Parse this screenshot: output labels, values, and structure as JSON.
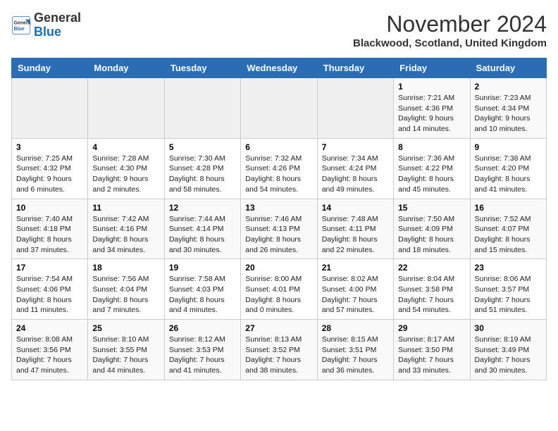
{
  "header": {
    "logo_line1": "General",
    "logo_line2": "Blue",
    "month": "November 2024",
    "location": "Blackwood, Scotland, United Kingdom"
  },
  "weekdays": [
    "Sunday",
    "Monday",
    "Tuesday",
    "Wednesday",
    "Thursday",
    "Friday",
    "Saturday"
  ],
  "weeks": [
    [
      {
        "day": "",
        "info": ""
      },
      {
        "day": "",
        "info": ""
      },
      {
        "day": "",
        "info": ""
      },
      {
        "day": "",
        "info": ""
      },
      {
        "day": "",
        "info": ""
      },
      {
        "day": "1",
        "info": "Sunrise: 7:21 AM\nSunset: 4:36 PM\nDaylight: 9 hours and 14 minutes."
      },
      {
        "day": "2",
        "info": "Sunrise: 7:23 AM\nSunset: 4:34 PM\nDaylight: 9 hours and 10 minutes."
      }
    ],
    [
      {
        "day": "3",
        "info": "Sunrise: 7:25 AM\nSunset: 4:32 PM\nDaylight: 9 hours and 6 minutes."
      },
      {
        "day": "4",
        "info": "Sunrise: 7:28 AM\nSunset: 4:30 PM\nDaylight: 9 hours and 2 minutes."
      },
      {
        "day": "5",
        "info": "Sunrise: 7:30 AM\nSunset: 4:28 PM\nDaylight: 8 hours and 58 minutes."
      },
      {
        "day": "6",
        "info": "Sunrise: 7:32 AM\nSunset: 4:26 PM\nDaylight: 8 hours and 54 minutes."
      },
      {
        "day": "7",
        "info": "Sunrise: 7:34 AM\nSunset: 4:24 PM\nDaylight: 8 hours and 49 minutes."
      },
      {
        "day": "8",
        "info": "Sunrise: 7:36 AM\nSunset: 4:22 PM\nDaylight: 8 hours and 45 minutes."
      },
      {
        "day": "9",
        "info": "Sunrise: 7:38 AM\nSunset: 4:20 PM\nDaylight: 8 hours and 41 minutes."
      }
    ],
    [
      {
        "day": "10",
        "info": "Sunrise: 7:40 AM\nSunset: 4:18 PM\nDaylight: 8 hours and 37 minutes."
      },
      {
        "day": "11",
        "info": "Sunrise: 7:42 AM\nSunset: 4:16 PM\nDaylight: 8 hours and 34 minutes."
      },
      {
        "day": "12",
        "info": "Sunrise: 7:44 AM\nSunset: 4:14 PM\nDaylight: 8 hours and 30 minutes."
      },
      {
        "day": "13",
        "info": "Sunrise: 7:46 AM\nSunset: 4:13 PM\nDaylight: 8 hours and 26 minutes."
      },
      {
        "day": "14",
        "info": "Sunrise: 7:48 AM\nSunset: 4:11 PM\nDaylight: 8 hours and 22 minutes."
      },
      {
        "day": "15",
        "info": "Sunrise: 7:50 AM\nSunset: 4:09 PM\nDaylight: 8 hours and 18 minutes."
      },
      {
        "day": "16",
        "info": "Sunrise: 7:52 AM\nSunset: 4:07 PM\nDaylight: 8 hours and 15 minutes."
      }
    ],
    [
      {
        "day": "17",
        "info": "Sunrise: 7:54 AM\nSunset: 4:06 PM\nDaylight: 8 hours and 11 minutes."
      },
      {
        "day": "18",
        "info": "Sunrise: 7:56 AM\nSunset: 4:04 PM\nDaylight: 8 hours and 7 minutes."
      },
      {
        "day": "19",
        "info": "Sunrise: 7:58 AM\nSunset: 4:03 PM\nDaylight: 8 hours and 4 minutes."
      },
      {
        "day": "20",
        "info": "Sunrise: 8:00 AM\nSunset: 4:01 PM\nDaylight: 8 hours and 0 minutes."
      },
      {
        "day": "21",
        "info": "Sunrise: 8:02 AM\nSunset: 4:00 PM\nDaylight: 7 hours and 57 minutes."
      },
      {
        "day": "22",
        "info": "Sunrise: 8:04 AM\nSunset: 3:58 PM\nDaylight: 7 hours and 54 minutes."
      },
      {
        "day": "23",
        "info": "Sunrise: 8:06 AM\nSunset: 3:57 PM\nDaylight: 7 hours and 51 minutes."
      }
    ],
    [
      {
        "day": "24",
        "info": "Sunrise: 8:08 AM\nSunset: 3:56 PM\nDaylight: 7 hours and 47 minutes."
      },
      {
        "day": "25",
        "info": "Sunrise: 8:10 AM\nSunset: 3:55 PM\nDaylight: 7 hours and 44 minutes."
      },
      {
        "day": "26",
        "info": "Sunrise: 8:12 AM\nSunset: 3:53 PM\nDaylight: 7 hours and 41 minutes."
      },
      {
        "day": "27",
        "info": "Sunrise: 8:13 AM\nSunset: 3:52 PM\nDaylight: 7 hours and 38 minutes."
      },
      {
        "day": "28",
        "info": "Sunrise: 8:15 AM\nSunset: 3:51 PM\nDaylight: 7 hours and 36 minutes."
      },
      {
        "day": "29",
        "info": "Sunrise: 8:17 AM\nSunset: 3:50 PM\nDaylight: 7 hours and 33 minutes."
      },
      {
        "day": "30",
        "info": "Sunrise: 8:19 AM\nSunset: 3:49 PM\nDaylight: 7 hours and 30 minutes."
      }
    ]
  ]
}
